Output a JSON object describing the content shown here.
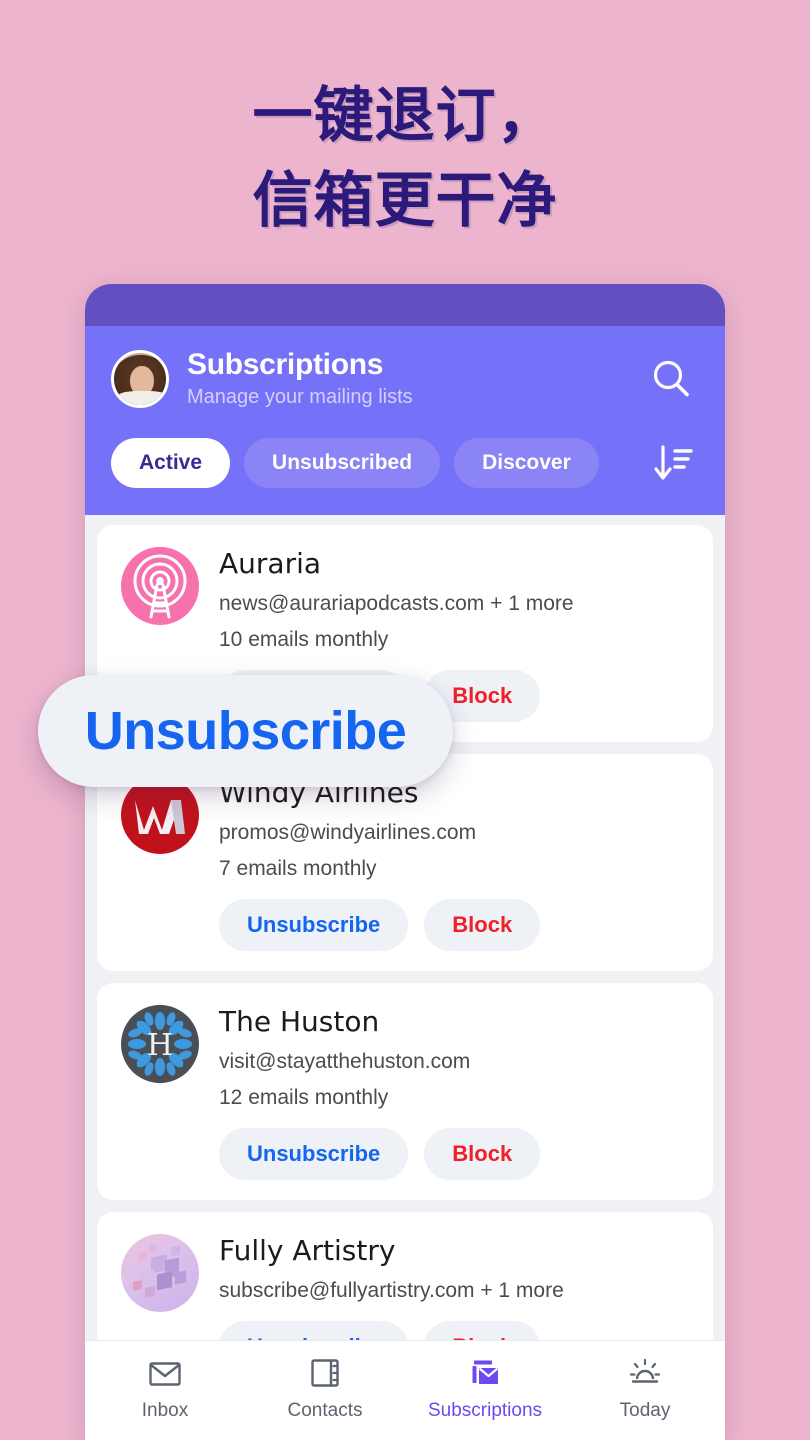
{
  "headline": {
    "line1": "一键退订，",
    "line2": "信箱更干净"
  },
  "colors": {
    "page_background": "#ecb4cd",
    "headline": "#2c1a7a",
    "statusbar": "#6250c0",
    "header": "#7571f8",
    "list_background": "#eff1f5",
    "card": "#ffffff",
    "unsubscribe": "#1565f0",
    "block": "#f0202a",
    "nav_active": "#7048f0"
  },
  "header": {
    "title": "Subscriptions",
    "subtitle": "Manage your mailing lists",
    "avatar_name": "user-avatar",
    "search_icon": "search-icon",
    "sort_icon": "sort-descending-icon",
    "chips": [
      {
        "label": "Active",
        "active": true
      },
      {
        "label": "Unsubscribed",
        "active": false
      },
      {
        "label": "Discover",
        "active": false
      }
    ]
  },
  "callout": {
    "label": "Unsubscribe"
  },
  "subscriptions": [
    {
      "name": "Auraria",
      "email": "news@aurariapodcasts.com + 1 more",
      "frequency": "10 emails monthly",
      "logo_icon": "broadcast-tower-icon",
      "unsubscribe_label": "Unsubscribe",
      "block_label": "Block"
    },
    {
      "name": "Windy Airlines",
      "email": "promos@windyairlines.com",
      "frequency": "7 emails monthly",
      "logo_icon": "windy-airlines-monogram-icon",
      "unsubscribe_label": "Unsubscribe",
      "block_label": "Block"
    },
    {
      "name": "The Huston",
      "email": "visit@stayatthehuston.com",
      "frequency": "12 emails monthly",
      "logo_icon": "huston-petal-monogram-icon",
      "unsubscribe_label": "Unsubscribe",
      "block_label": "Block"
    },
    {
      "name": "Fully Artistry",
      "email": "subscribe@fullyartistry.com + 1 more",
      "frequency": "",
      "logo_icon": "cubes-artwork-icon",
      "unsubscribe_label": "Unsubscribe",
      "block_label": "Block"
    }
  ],
  "bottom_nav": [
    {
      "label": "Inbox",
      "icon": "envelope-icon",
      "active": false
    },
    {
      "label": "Contacts",
      "icon": "contact-card-icon",
      "active": false
    },
    {
      "label": "Subscriptions",
      "icon": "subscriptions-envelope-icon",
      "active": true
    },
    {
      "label": "Today",
      "icon": "sunrise-icon",
      "active": false
    }
  ]
}
